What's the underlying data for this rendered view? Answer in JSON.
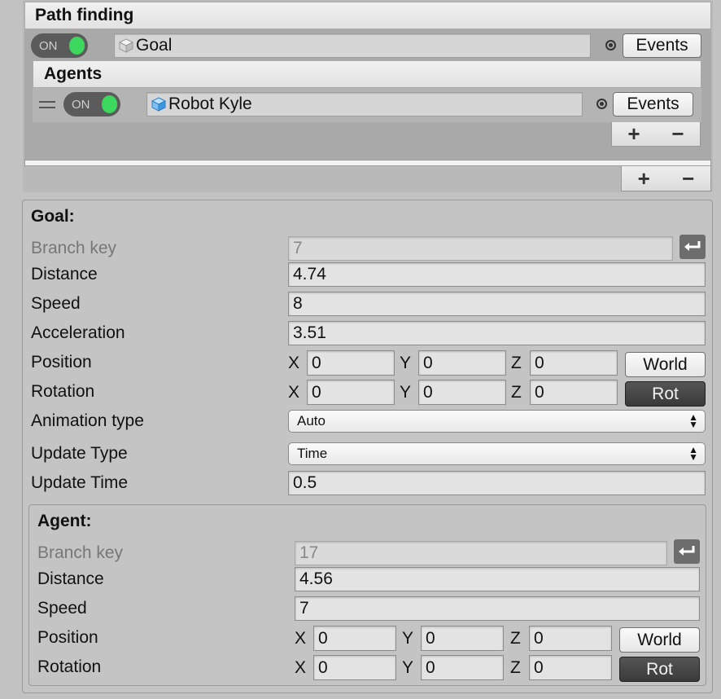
{
  "path_finding": {
    "title": "Path finding",
    "toggle_label": "ON",
    "goal_object": "Goal",
    "events_label": "Events",
    "agents": {
      "title": "Agents",
      "toggle_label": "ON",
      "agent_object": "Robot Kyle",
      "events_label": "Events",
      "add_symbol": "+",
      "remove_symbol": "−"
    },
    "add_symbol": "+",
    "remove_symbol": "−"
  },
  "goal": {
    "title": "Goal:",
    "branch_key_label": "Branch key",
    "branch_key_value": "7",
    "distance_label": "Distance",
    "distance_value": "4.74",
    "speed_label": "Speed",
    "speed_value": "8",
    "acceleration_label": "Acceleration",
    "acceleration_value": "3.51",
    "position_label": "Position",
    "position": {
      "x_label": "X",
      "x": "0",
      "y_label": "Y",
      "y": "0",
      "z_label": "Z",
      "z": "0"
    },
    "world_label": "World",
    "rotation_label": "Rotation",
    "rotation": {
      "x_label": "X",
      "x": "0",
      "y_label": "Y",
      "y": "0",
      "z_label": "Z",
      "z": "0"
    },
    "rot_label": "Rot",
    "animation_type_label": "Animation type",
    "animation_type_value": "Auto",
    "update_type_label": "Update Type",
    "update_type_value": "Time",
    "update_time_label": "Update Time",
    "update_time_value": "0.5"
  },
  "agent": {
    "title": "Agent:",
    "branch_key_label": "Branch key",
    "branch_key_value": "17",
    "distance_label": "Distance",
    "distance_value": "4.56",
    "speed_label": "Speed",
    "speed_value": "7",
    "position_label": "Position",
    "position": {
      "x_label": "X",
      "x": "0",
      "y_label": "Y",
      "y": "0",
      "z_label": "Z",
      "z": "0"
    },
    "world_label": "World",
    "rotation_label": "Rotation",
    "rotation": {
      "x_label": "X",
      "x": "0",
      "y_label": "Y",
      "y": "0",
      "z_label": "Z",
      "z": "0"
    },
    "rot_label": "Rot"
  },
  "colors": {
    "toggle_on": "#3cd85e",
    "toggle_bg": "#5b5b5b",
    "rot_button": "#444444"
  }
}
